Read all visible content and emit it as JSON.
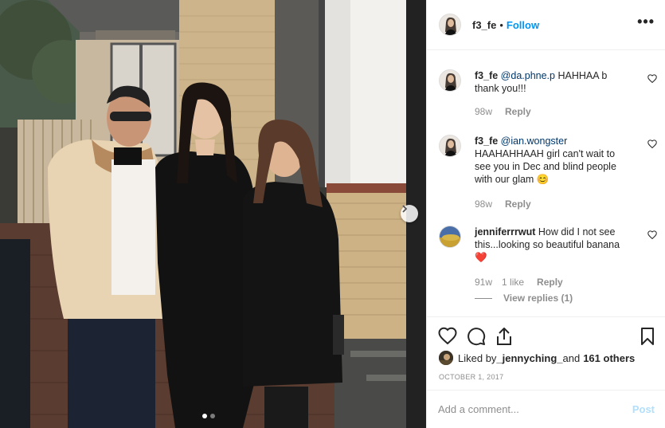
{
  "header": {
    "username": "f3_fe",
    "separator": "•",
    "follow_label": "Follow",
    "more_label": "•••"
  },
  "comments": [
    {
      "username": "f3_fe",
      "mention": "@da.phne.p",
      "text": " HAHHAA b thank you!!!",
      "age": "98w",
      "reply_label": "Reply"
    },
    {
      "username": "f3_fe",
      "mention": "@ian.wongster",
      "text": " HAAHAHHAAH girl can't wait to see you in Dec and blind people with our glam",
      "emoji": "😊",
      "age": "98w",
      "reply_label": "Reply"
    },
    {
      "username": "jenniferrrwut",
      "text": " How did I not see this...looking so beautiful banana",
      "emoji": "❤️",
      "age": "91w",
      "likes": "1 like",
      "reply_label": "Reply",
      "view_replies": "View replies (1)"
    }
  ],
  "likes": {
    "prefix": "Liked by ",
    "user": "_jennyching_",
    "middle": " and ",
    "others": "161 others"
  },
  "date": "OCTOBER 1, 2017",
  "add_comment": {
    "placeholder": "Add a comment...",
    "post_label": "Post"
  },
  "carousel": {
    "total": 2,
    "active": 0
  },
  "icons": [
    "chevron-right-icon",
    "more-icon",
    "heart-icon",
    "comment-icon",
    "share-icon",
    "bookmark-icon"
  ]
}
